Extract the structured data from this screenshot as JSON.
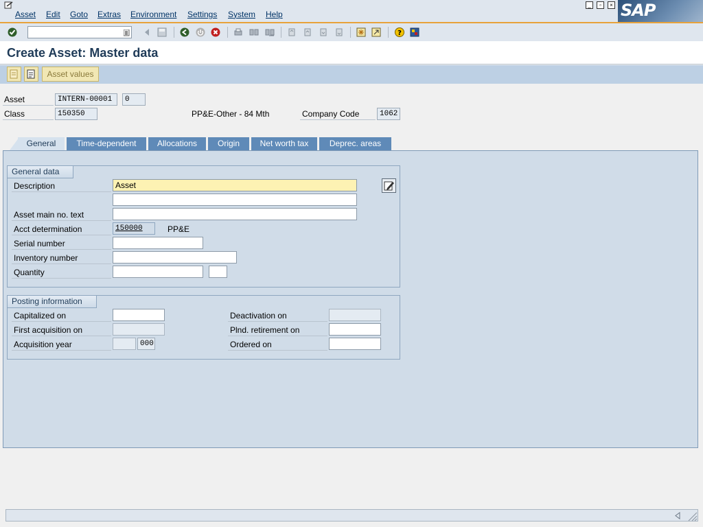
{
  "menu": {
    "items": [
      "Asset",
      "Edit",
      "Goto",
      "Extras",
      "Environment",
      "Settings",
      "System",
      "Help"
    ]
  },
  "logo": {
    "text": "SAP"
  },
  "toolbar": {
    "command_field_value": ""
  },
  "title": "Create Asset:  Master data",
  "app_toolbar": {
    "asset_values_label": "Asset values"
  },
  "header": {
    "asset_label": "Asset",
    "asset_value": "INTERN-00001",
    "asset_sub": "0",
    "class_label": "Class",
    "class_value": "150350",
    "class_text": "PP&E-Other - 84 Mth",
    "company_code_label": "Company Code",
    "company_code_value": "1062"
  },
  "tabs": [
    "General",
    "Time-dependent",
    "Allocations",
    "Origin",
    "Net worth tax",
    "Deprec. areas"
  ],
  "general_data": {
    "title": "General data",
    "description_label": "Description",
    "description_value": "Asset",
    "description2_value": "",
    "main_text_label": "Asset main no. text",
    "main_text_value": "",
    "acct_det_label": "Acct determination",
    "acct_det_value": "150000",
    "acct_det_text": "PP&E",
    "serial_label": "Serial number",
    "serial_value": "",
    "inventory_label": "Inventory number",
    "inventory_value": "",
    "quantity_label": "Quantity",
    "quantity_value": "",
    "unit_value": ""
  },
  "posting_info": {
    "title": "Posting information",
    "capitalized_label": "Capitalized on",
    "capitalized_value": "",
    "first_acq_label": "First acquisition on",
    "first_acq_value": "",
    "acq_year_label": "Acquisition year",
    "acq_year_value": "",
    "acq_period_value": "000",
    "deactivation_label": "Deactivation on",
    "deactivation_value": "",
    "planned_retirement_label": "Plnd. retirement on",
    "planned_retirement_value": "",
    "ordered_label": "Ordered on",
    "ordered_value": ""
  },
  "status_bar": {
    "message": ""
  },
  "colors": {
    "accent": "#e8a23a",
    "tab_blue": "#5f8ab8",
    "panel": "#d0dce8",
    "title_text": "#1f3b58"
  }
}
